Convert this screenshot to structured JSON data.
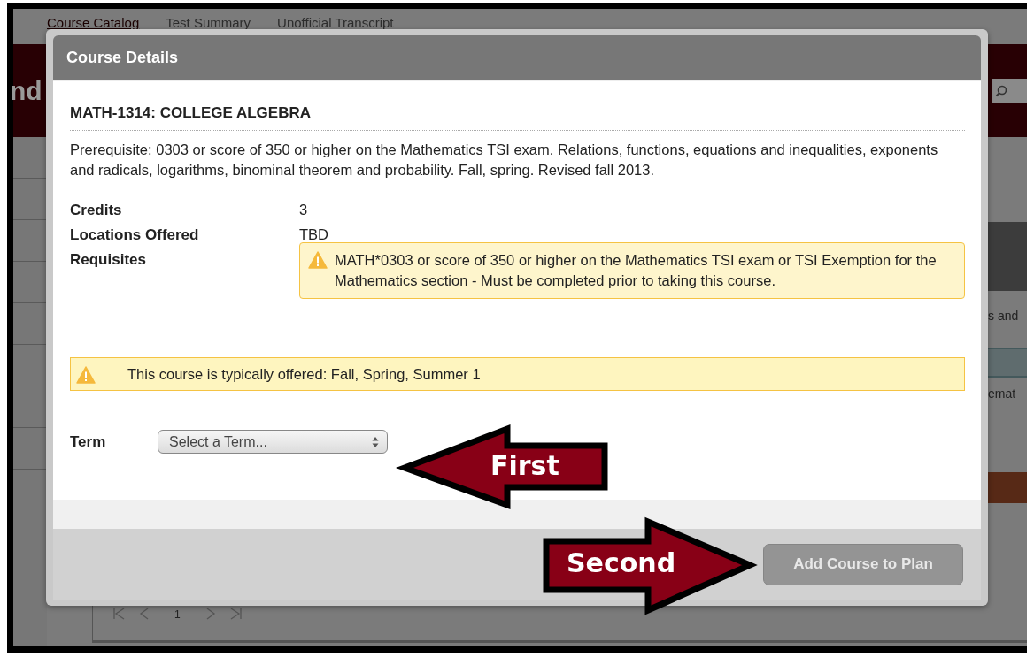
{
  "background": {
    "nav_tabs": [
      {
        "label": "Course Catalog",
        "selected": true
      },
      {
        "label": "Test Summary",
        "selected": false
      },
      {
        "label": "Unofficial Transcript",
        "selected": false
      }
    ],
    "header_fragment": "nd",
    "right_fragments": [
      "s and",
      "emat"
    ],
    "pager": {
      "page": "1"
    }
  },
  "modal": {
    "title": "Course Details",
    "course_title": "MATH-1314: COLLEGE ALGEBRA",
    "description": "Prerequisite: 0303 or score of 350 or higher on the Mathematics TSI exam. Relations, functions, equations and inequalities, exponents and radicals, logarithms, binominal theorem and probability. Fall, spring. Revised fall 2013.",
    "details": [
      {
        "label": "Credits",
        "kind": "text",
        "value": "3"
      },
      {
        "label": "Locations Offered",
        "kind": "text",
        "value": "TBD"
      },
      {
        "label": "Requisites",
        "kind": "warning",
        "value": "MATH*0303 or score of 350 or higher on the Mathematics TSI exam or TSI Exemption for the Mathematics section - Must be completed prior to taking this course."
      }
    ],
    "offered_notice": "This course is typically offered: Fall, Spring, Summer 1",
    "term": {
      "label": "Term",
      "value": "Select a Term..."
    },
    "primary_button": {
      "label": "Add Course to Plan",
      "disabled": true
    }
  },
  "annotations": [
    {
      "label": "First",
      "kind": "left-arrow"
    },
    {
      "label": "Second",
      "kind": "right-arrow"
    }
  ]
}
